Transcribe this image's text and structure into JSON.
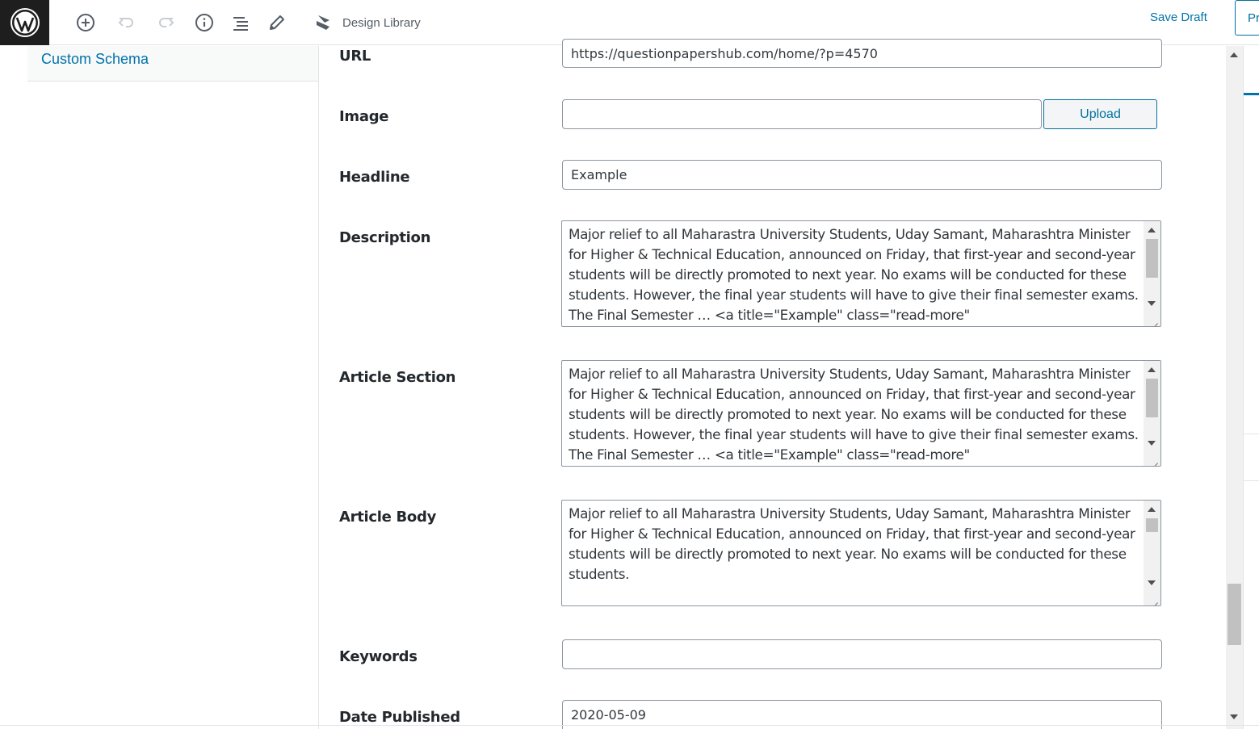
{
  "toolbar": {
    "add_block": "plus-circle-icon",
    "undo": "undo-icon",
    "redo": "redo-icon",
    "info": "info-icon",
    "outline": "list-icon",
    "tools": "pencil-icon",
    "design_library_label": "Design Library",
    "save_draft_label": "Save Draft",
    "preview_label": "Pr"
  },
  "sidebar": {
    "items": [
      {
        "label": "Custom Schema"
      }
    ]
  },
  "form": {
    "url": {
      "label": "URL",
      "value": "https://questionpapershub.com/home/?p=4570"
    },
    "image": {
      "label": "Image",
      "value": "",
      "upload_label": "Upload"
    },
    "headline": {
      "label": "Headline",
      "value": "Example"
    },
    "description": {
      "label": "Description",
      "value": "Major relief to all Maharastra University Students, Uday Samant, Maharashtra Minister for Higher & Technical Education, announced on Friday, that first-year and second-year students will be directly promoted to next year. No exams will be conducted for these students. However, the final year students will have to give their final semester exams. The Final Semester … <a title=\"Example\" class=\"read-more\""
    },
    "article_section": {
      "label": "Article Section",
      "value": "Major relief to all Maharastra University Students, Uday Samant, Maharashtra Minister for Higher & Technical Education, announced on Friday, that first-year and second-year students will be directly promoted to next year. No exams will be conducted for these students. However, the final year students will have to give their final semester exams. The Final Semester … <a title=\"Example\" class=\"read-more\""
    },
    "article_body": {
      "label": "Article Body",
      "value": "Major relief to all Maharastra University Students, Uday Samant, Maharashtra Minister for Higher & Technical Education, announced on Friday, that first-year and second-year students will be directly promoted to next year. No exams will be conducted for these students."
    },
    "keywords": {
      "label": "Keywords",
      "value": ""
    },
    "date_published": {
      "label": "Date Published",
      "value": "2020-05-09"
    }
  },
  "colors": {
    "accent": "#0073aa",
    "dark": "#1e1e1e"
  }
}
